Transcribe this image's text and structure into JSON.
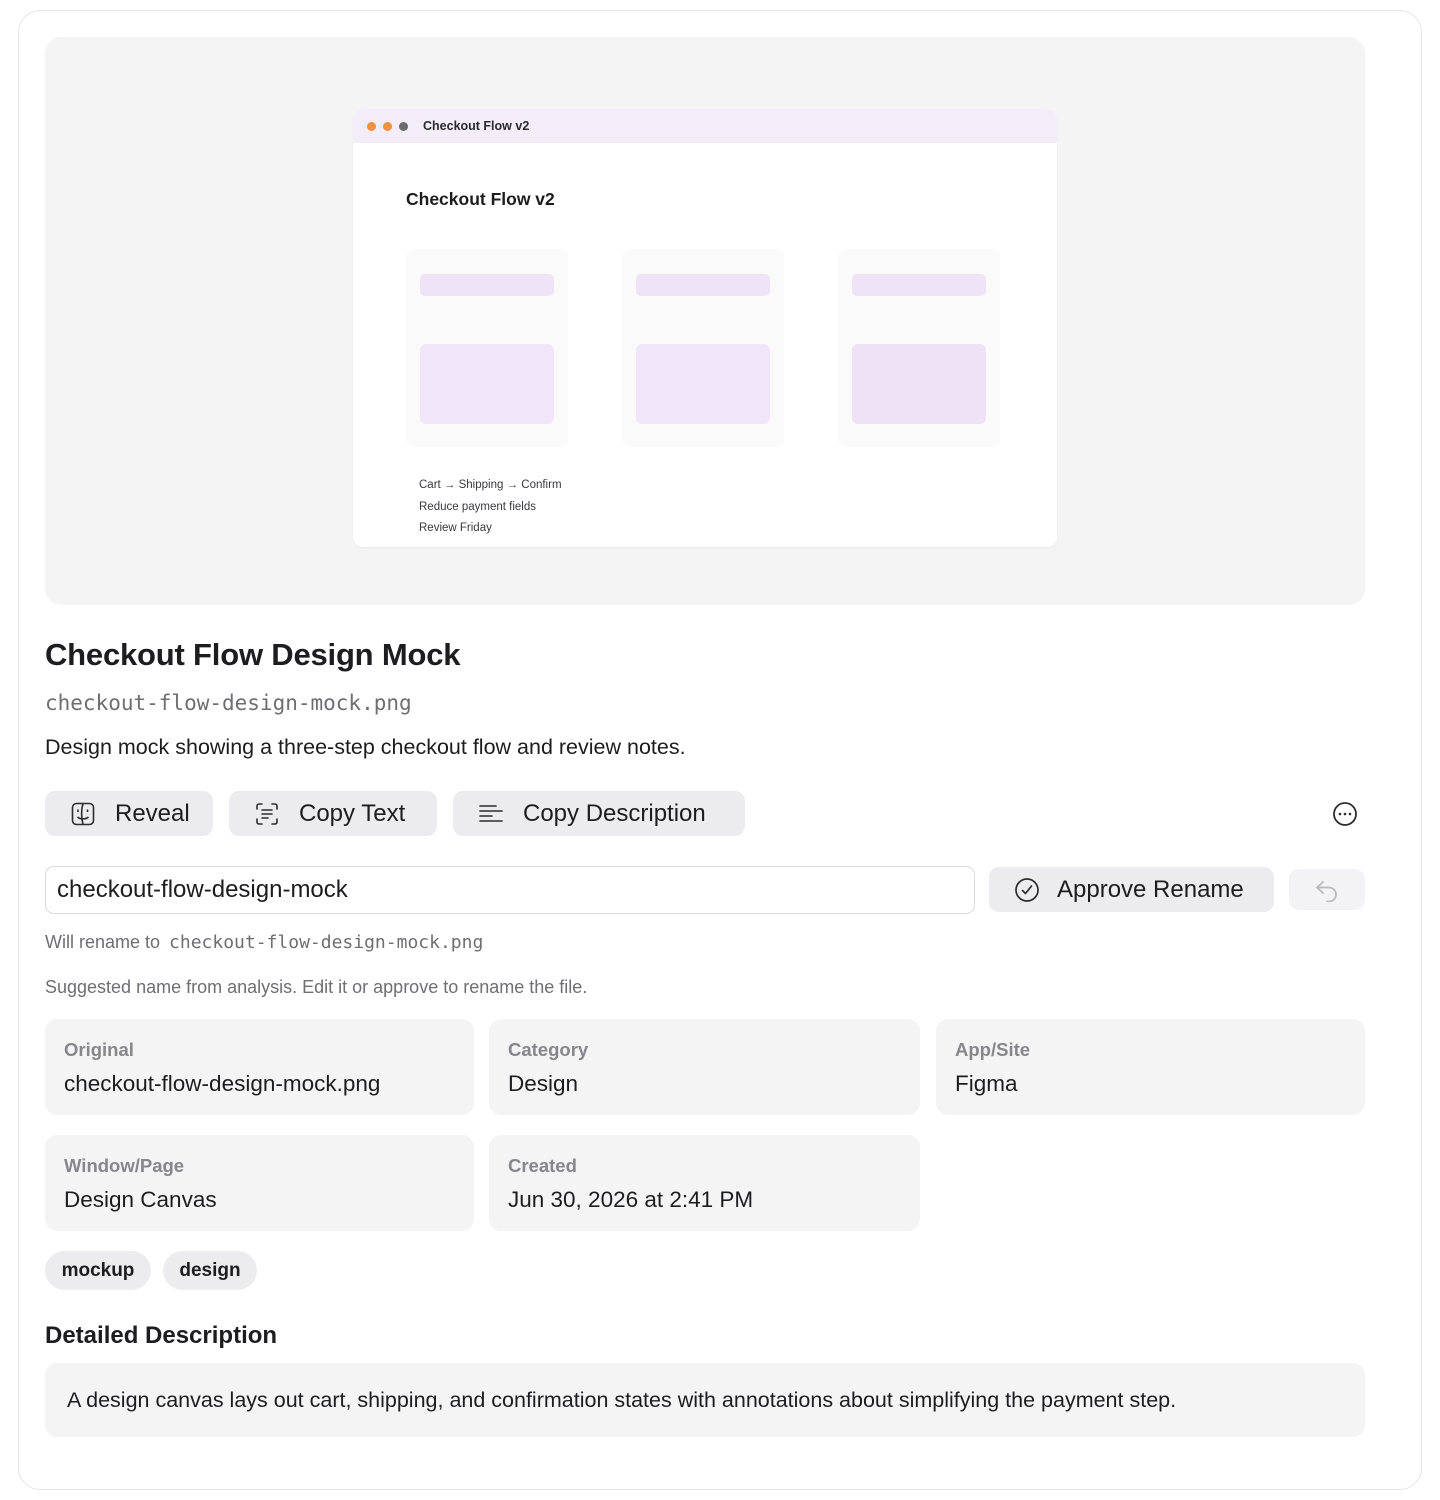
{
  "preview": {
    "window_title": "Checkout Flow v2",
    "heading": "Checkout Flow v2",
    "dots": [
      "#f0923d",
      "#f0923d",
      "#6b6b6f"
    ],
    "notes": [
      "Cart → Shipping → Confirm",
      "Reduce payment fields",
      "Review Friday"
    ]
  },
  "header": {
    "title": "Checkout Flow Design Mock",
    "filename": "checkout-flow-design-mock.png",
    "description": "Design mock showing a three-step checkout flow and review notes."
  },
  "actions": {
    "reveal_label": "Reveal",
    "reveal_icon": "finder-icon",
    "copy_text_label": "Copy Text",
    "copy_text_icon": "text-scan-icon",
    "copy_description_label": "Copy Description",
    "copy_description_icon": "text-lines-icon",
    "more_icon": "ellipsis-circle-icon"
  },
  "rename": {
    "input_value": "checkout-flow-design-mock",
    "approve_label": "Approve Rename",
    "approve_icon": "checkmark-circle-icon",
    "undo_icon": "undo-arrow-icon",
    "will_rename_prefix": "Will rename to",
    "will_rename_target": "checkout-flow-design-mock.png",
    "hint": "Suggested name from analysis. Edit it or approve to rename the file."
  },
  "info": [
    {
      "label": "Original",
      "value": "checkout-flow-design-mock.png"
    },
    {
      "label": "Category",
      "value": "Design"
    },
    {
      "label": "App/Site",
      "value": "Figma"
    },
    {
      "label": "Window/Page",
      "value": "Design Canvas"
    },
    {
      "label": "Created",
      "value": "Jun 30, 2026 at 2:41 PM"
    }
  ],
  "tags": [
    "mockup",
    "design"
  ],
  "detailed": {
    "title": "Detailed Description",
    "text": "A design canvas lays out cart, shipping, and confirmation states with annotations about simplifying the payment step."
  },
  "colors": {
    "accent_lavender": "#f3edf9",
    "card_bg": "#f4f4f5",
    "button_bg": "#ececee",
    "secondary_text": "#6e6e73"
  }
}
